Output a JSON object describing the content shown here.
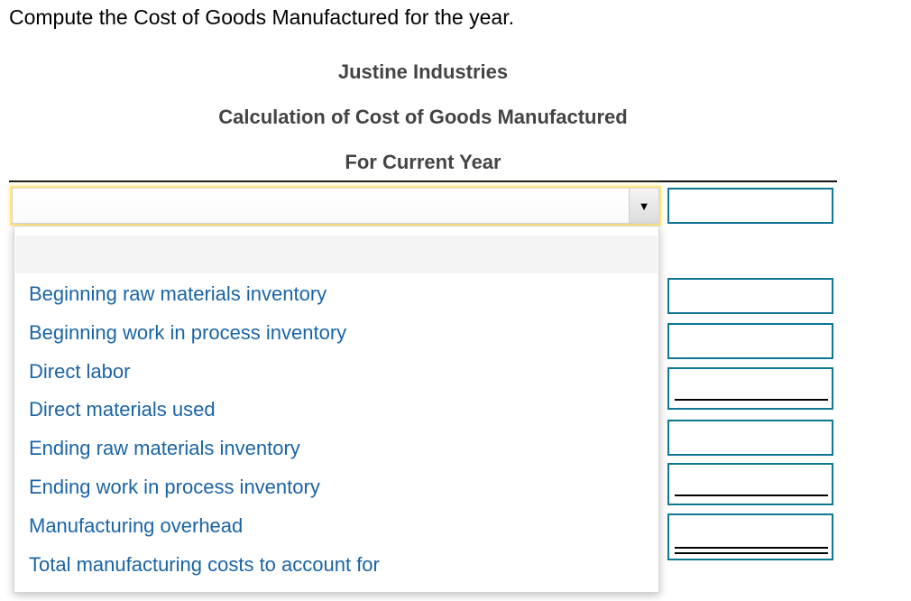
{
  "instruction": "Compute the Cost of Goods Manufactured for the year.",
  "header": {
    "company": "Justine Industries",
    "title": "Calculation of Cost of Goods Manufactured",
    "period": "For Current Year"
  },
  "select": {
    "value": "",
    "arrow_icon": "triangle-down"
  },
  "dropdown": {
    "options": [
      "",
      "Beginning raw materials inventory",
      "Beginning work in process inventory",
      "Direct labor",
      "Direct materials used",
      "Ending raw materials inventory",
      "Ending work in process inventory",
      "Manufacturing overhead",
      "Total manufacturing costs to account for"
    ]
  },
  "amounts": [
    {
      "value": "",
      "underline": "none"
    },
    {
      "value": "",
      "underline": "none"
    },
    {
      "value": "",
      "underline": "none"
    },
    {
      "value": "",
      "underline": "single"
    },
    {
      "value": "",
      "underline": "none"
    },
    {
      "value": "",
      "underline": "single"
    },
    {
      "value": "",
      "underline": "double"
    }
  ],
  "colors": {
    "option_text": "#1a64a6",
    "input_border": "#0f7694",
    "focus_glow": "#ffe680"
  }
}
